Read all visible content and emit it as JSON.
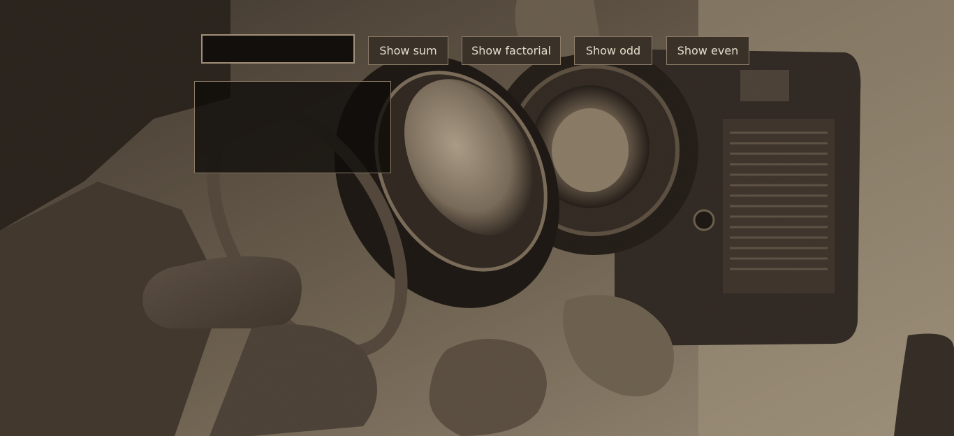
{
  "form": {
    "number_input": {
      "value": "",
      "placeholder": ""
    },
    "buttons": {
      "sum_label": "Show sum",
      "factorial_label": "Show factorial",
      "odd_label": "Show odd",
      "even_label": "Show even"
    },
    "output": {
      "text": ""
    }
  },
  "background": {
    "subject": "camera-photo",
    "tone": "sepia"
  }
}
